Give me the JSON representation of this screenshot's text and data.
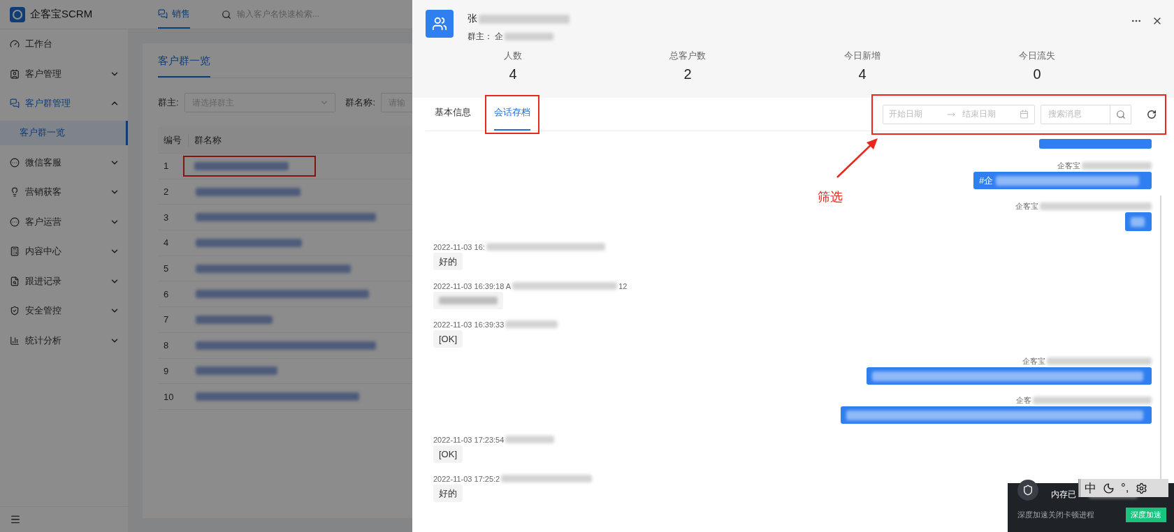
{
  "app": {
    "logo": "企客宝SCRM",
    "top_tab": {
      "label": "销售",
      "selected": true
    },
    "search": {
      "placeholder": "输入客户名快速检索..."
    }
  },
  "sidebar": {
    "items": [
      {
        "label": "工作台",
        "kind": "link",
        "selected": false
      },
      {
        "label": "客户管理",
        "kind": "group",
        "expanded": false,
        "selected": false
      },
      {
        "label": "客户群管理",
        "kind": "group",
        "expanded": true,
        "selected": true,
        "children": [
          {
            "label": "客户群一览",
            "selected": true
          }
        ]
      },
      {
        "label": "微信客服",
        "kind": "group",
        "expanded": false,
        "selected": false
      },
      {
        "label": "营销获客",
        "kind": "group",
        "expanded": false,
        "selected": false
      },
      {
        "label": "客户运营",
        "kind": "group",
        "expanded": false,
        "selected": false
      },
      {
        "label": "内容中心",
        "kind": "group",
        "expanded": false,
        "selected": false
      },
      {
        "label": "跟进记录",
        "kind": "group",
        "expanded": false,
        "selected": false
      },
      {
        "label": "安全管控",
        "kind": "group",
        "expanded": false,
        "selected": false
      },
      {
        "label": "统计分析",
        "kind": "group",
        "expanded": false,
        "selected": false
      }
    ]
  },
  "page": {
    "tab": "客户群一览",
    "filters": [
      {
        "kind": "select",
        "label": "群主:",
        "placeholder": "请选择群主"
      },
      {
        "kind": "input",
        "label": "群名称:",
        "placeholder": "请输"
      }
    ],
    "table": {
      "columns": [
        "编号",
        "群名称"
      ],
      "rows": [
        {
          "number": "1",
          "annotated": true
        },
        {
          "number": "2",
          "annotated": false
        },
        {
          "number": "3",
          "annotated": false
        },
        {
          "number": "4",
          "annotated": false
        },
        {
          "number": "5",
          "annotated": false
        },
        {
          "number": "6",
          "annotated": false
        },
        {
          "number": "7",
          "annotated": false
        },
        {
          "number": "8",
          "annotated": false
        },
        {
          "number": "9",
          "annotated": false
        },
        {
          "number": "10",
          "annotated": false
        }
      ]
    }
  },
  "drawer": {
    "title": "张",
    "owner_label": "群主：",
    "owner": "企",
    "stats": [
      {
        "label": "人数",
        "value": "4"
      },
      {
        "label": "总客户数",
        "value": "2"
      },
      {
        "label": "今日新增",
        "value": "4"
      },
      {
        "label": "今日流失",
        "value": "0"
      }
    ],
    "tabs": [
      {
        "label": "基本信息",
        "selected": false,
        "annotated": false
      },
      {
        "label": "会话存档",
        "selected": true,
        "annotated": true
      }
    ],
    "filter": {
      "annotated": true,
      "start_placeholder": "开始日期",
      "end_placeholder": "结束日期",
      "search_placeholder": "搜索消息"
    },
    "messages": [
      {
        "kind": "sent"
      },
      {
        "kind": "sent",
        "sender": "企客宝",
        "text": "#企"
      },
      {
        "kind": "sent",
        "sender": "企客宝"
      },
      {
        "kind": "received",
        "time": "2022-11-03 16:",
        "text": "好的"
      },
      {
        "kind": "received",
        "time": "2022-11-03 16:39:18 A",
        "time_end": "12"
      },
      {
        "kind": "received",
        "time": "2022-11-03 16:39:33",
        "text": "[OK]"
      },
      {
        "kind": "sent",
        "sender": "企客宝"
      },
      {
        "kind": "sent",
        "sender": "企客"
      },
      {
        "kind": "received",
        "time": "2022-11-03 17:23:54",
        "text": "[OK]"
      },
      {
        "kind": "received",
        "time": "2022-11-03 17:25:2",
        "text": "好的"
      }
    ]
  },
  "annotation": {
    "label": "筛选"
  },
  "toast": {
    "title": "内存已",
    "text": "深度加速关闭卡顿进程",
    "button": "深度加速"
  },
  "ime_bar": {
    "mode": "中",
    "punctuation": "°,"
  }
}
